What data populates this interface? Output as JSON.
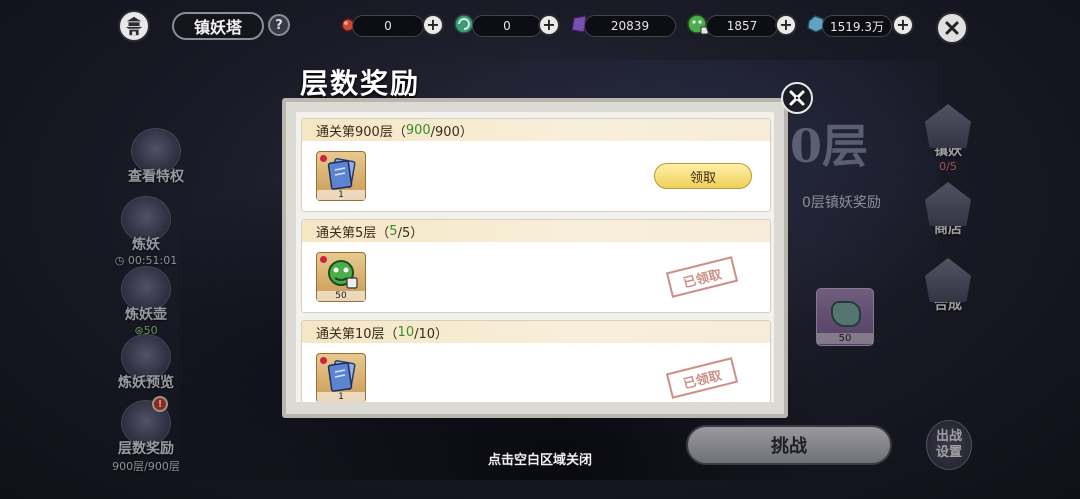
{
  "topbar": {
    "tower_name": "镇妖塔",
    "help": "?",
    "resources": [
      {
        "icon": "red-orb-icon",
        "value": "0"
      },
      {
        "icon": "green-swirl-icon",
        "value": "0"
      },
      {
        "icon": "purple-crystal-icon",
        "value": "20839"
      },
      {
        "icon": "green-beast-lock-icon",
        "value": "1857"
      },
      {
        "icon": "blue-stone-icon",
        "value": "1519.3万"
      }
    ],
    "plus": "+"
  },
  "left_menu": [
    {
      "label": "查看特权",
      "sub": ""
    },
    {
      "label": "炼妖",
      "sub": "00:51:01"
    },
    {
      "label": "炼妖壶",
      "sub": "50"
    },
    {
      "label": "炼妖预览",
      "sub": ""
    },
    {
      "label": "层数奖励",
      "sub": "900层/900层",
      "badge": "!"
    }
  ],
  "right_menu": [
    {
      "label": "镇妖",
      "sub": "0/5"
    },
    {
      "label": "商店",
      "sub": ""
    },
    {
      "label": "合成",
      "sub": ""
    }
  ],
  "background": {
    "floor_text": "0层",
    "reward_text": "0层镇妖奖励",
    "item_count": "50",
    "challenge": "挑战",
    "battle_settings": "出战设置",
    "tap_close": "点击空白区域关闭"
  },
  "modal": {
    "title": "层数奖励",
    "cards": [
      {
        "prefix": "通关第900层（",
        "cur": "900",
        "total": "/900）",
        "item_qty": "1",
        "item_icon": "blue-card-icon",
        "action": "领取",
        "claimed": false
      },
      {
        "prefix": "通关第5层（",
        "cur": "5",
        "total": "/5）",
        "item_qty": "50",
        "item_icon": "green-beast-lock-icon",
        "action": "已领取",
        "claimed": true
      },
      {
        "prefix": "通关第10层（",
        "cur": "10",
        "total": "/10）",
        "item_qty": "1",
        "item_icon": "blue-card-icon",
        "action": "已领取",
        "claimed": true
      }
    ]
  }
}
